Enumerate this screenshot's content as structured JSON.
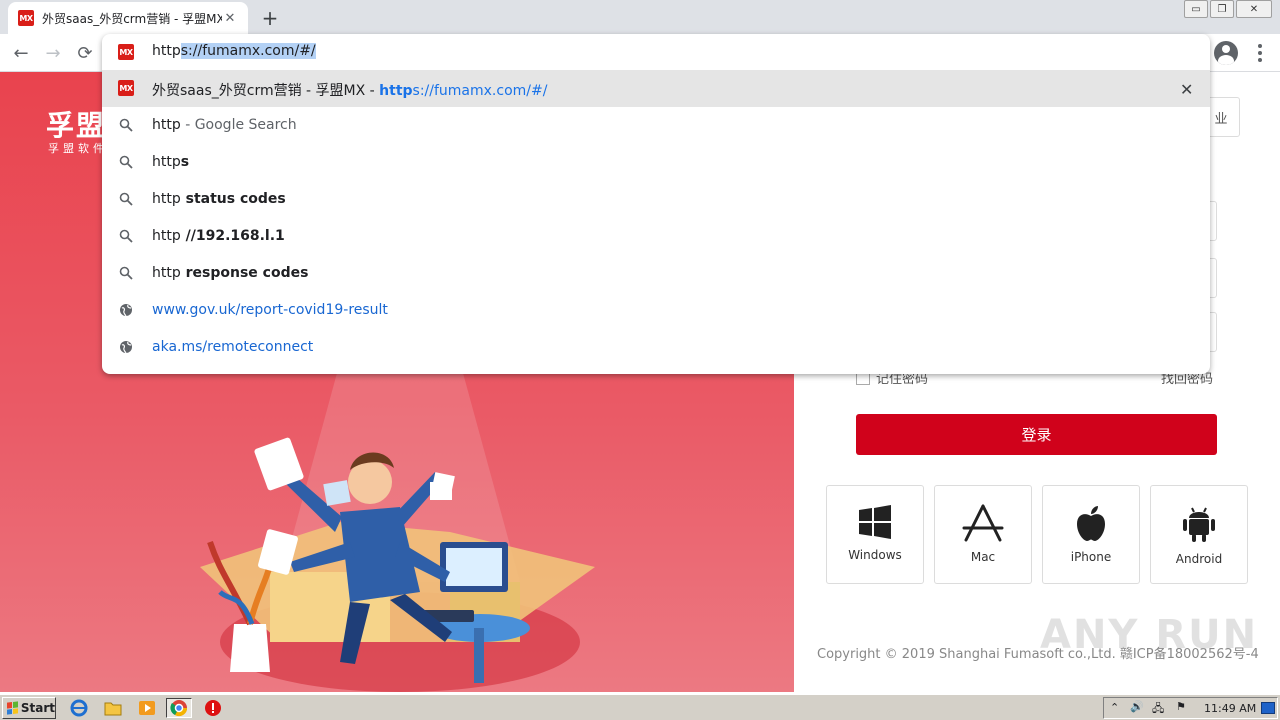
{
  "browser": {
    "tab": {
      "favicon_text": "MX",
      "title": "外贸saas_外贸crm营销 - 孚盟MX",
      "close_glyph": "✕"
    },
    "new_tab_glyph": "+",
    "window_controls": [
      "▭",
      "❐",
      "✕"
    ],
    "nav": {
      "back": "←",
      "forward": "→",
      "reload": "⟳"
    }
  },
  "omnibox": {
    "typed": "http",
    "autocompleted": "s://fumamx.com/#/",
    "suggestions": [
      {
        "icon": "favicon-mx",
        "parts": [
          {
            "t": "外贸saas_外贸crm营销 - 孚盟MX - ",
            "c": ""
          },
          {
            "t": "http",
            "c": "url b"
          },
          {
            "t": "s://fumamx.com/#/",
            "c": "url"
          }
        ],
        "highlighted": true,
        "removable": true
      },
      {
        "icon": "search-icon",
        "parts": [
          {
            "t": "http",
            "c": ""
          },
          {
            "t": " - Google Search",
            "c": "dim"
          }
        ]
      },
      {
        "icon": "search-icon",
        "parts": [
          {
            "t": "http",
            "c": ""
          },
          {
            "t": "s",
            "c": "b"
          }
        ]
      },
      {
        "icon": "search-icon",
        "parts": [
          {
            "t": "http",
            "c": ""
          },
          {
            "t": " status codes",
            "c": "b"
          }
        ]
      },
      {
        "icon": "search-icon",
        "parts": [
          {
            "t": "http",
            "c": ""
          },
          {
            "t": " //192.168.l.1",
            "c": "b"
          }
        ]
      },
      {
        "icon": "search-icon",
        "parts": [
          {
            "t": "http",
            "c": ""
          },
          {
            "t": " response codes",
            "c": "b"
          }
        ]
      },
      {
        "icon": "globe-icon",
        "parts": [
          {
            "t": "www.gov.uk/report-covid19-result",
            "c": "link"
          }
        ]
      },
      {
        "icon": "globe-icon",
        "parts": [
          {
            "t": "aka.ms/remoteconnect",
            "c": "link"
          }
        ]
      }
    ],
    "remove_glyph": "✕"
  },
  "page": {
    "brand": "孚盟",
    "brand_sub": "孚盟软件",
    "enterprise_partial": "业",
    "remember_label": "记住密码",
    "forgot_label": "找回密码",
    "login_label": "登录",
    "platforms": [
      "Windows",
      "Mac",
      "iPhone",
      "Android"
    ],
    "copyright": "Copyright © 2019 Shanghai Fumasoft co.,Ltd.  赣ICP备18002562号-4",
    "watermark": "ANY RUN"
  },
  "taskbar": {
    "start_label": "Start",
    "clock": "11:49 AM",
    "tray_icons": [
      "⌃",
      "🔊",
      "🖧",
      "⚑"
    ]
  },
  "colors": {
    "brand_red": "#d0021b",
    "hero_red": "#e9434e",
    "link_blue": "#1967d2",
    "selection": "#b3d1f5"
  }
}
